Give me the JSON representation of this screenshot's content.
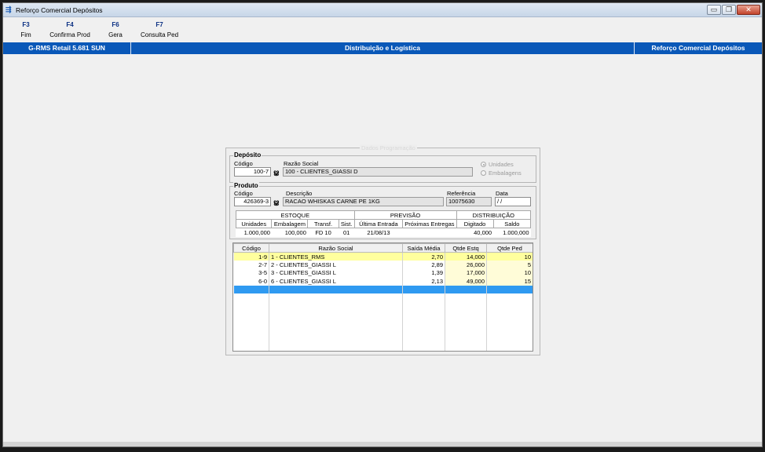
{
  "window": {
    "title": "Reforço Comercial Depósitos",
    "controls": {
      "minimize": "▭",
      "restore": "❐",
      "close": "✕"
    }
  },
  "fkeys": [
    {
      "key": "F3",
      "label": "Fim"
    },
    {
      "key": "F4",
      "label": "Confirma Prod"
    },
    {
      "key": "F6",
      "label": "Gera"
    },
    {
      "key": "F7",
      "label": "Consulta Ped"
    }
  ],
  "statusbar": {
    "left": "G-RMS Retail 5.681 SUN",
    "center": "Distribuição e Logística",
    "right": "Reforço Comercial Depósitos",
    "color": "#0a58b8"
  },
  "panel": {
    "title": "Dados Programação",
    "deposito": {
      "group_label": "Depósito",
      "codigo_label": "Código",
      "codigo_value": "100-7",
      "razao_label": "Razão Social",
      "razao_value": "100 - CLIENTES_GIASSI D",
      "radio_unidades": "Unidades",
      "radio_embalagens": "Embalagens"
    },
    "produto": {
      "group_label": "Produto",
      "codigo_label": "Código",
      "codigo_value": "426369-3",
      "descricao_label": "Descrição",
      "descricao_value": "RACAO WHISKAS CARNE        PE   1KG",
      "referencia_label": "Referência",
      "referencia_value": "10075630",
      "data_label": "Data",
      "data_value": " / /"
    },
    "stock": {
      "groups": [
        "ESTOQUE",
        "PREVISÃO",
        "DISTRIBUIÇÃO"
      ],
      "headers": [
        "Unidades",
        "Embalagem",
        "Transf.",
        "Sist.",
        "Última Entrada",
        "Próximas Entregas",
        "Digitado",
        "Saldo"
      ],
      "values": [
        "1.000,000",
        "100,000",
        "FD 10",
        "01",
        "21/08/13",
        "",
        "40,000",
        "1.000,000"
      ]
    },
    "grid": {
      "columns": [
        "Código",
        "Razão Social",
        "Saída Média",
        "Qtde Estq",
        "Qtde Ped"
      ],
      "rows": [
        {
          "codigo": "1-9",
          "razao": "1 - CLIENTES_RMS",
          "saida": "2,70",
          "estq": "14,000",
          "ped": "10"
        },
        {
          "codigo": "2-7",
          "razao": "2 - CLIENTES_GIASSI L",
          "saida": "2,89",
          "estq": "26,000",
          "ped": "5"
        },
        {
          "codigo": "3-5",
          "razao": "3 - CLIENTES_GIASSI L",
          "saida": "1,39",
          "estq": "17,000",
          "ped": "10"
        },
        {
          "codigo": "6-0",
          "razao": "6 - CLIENTES_GIASSI L",
          "saida": "2,13",
          "estq": "49,000",
          "ped": "15"
        }
      ],
      "highlight_color": "#ffff9e",
      "selection_color": "#2f9af1"
    }
  }
}
